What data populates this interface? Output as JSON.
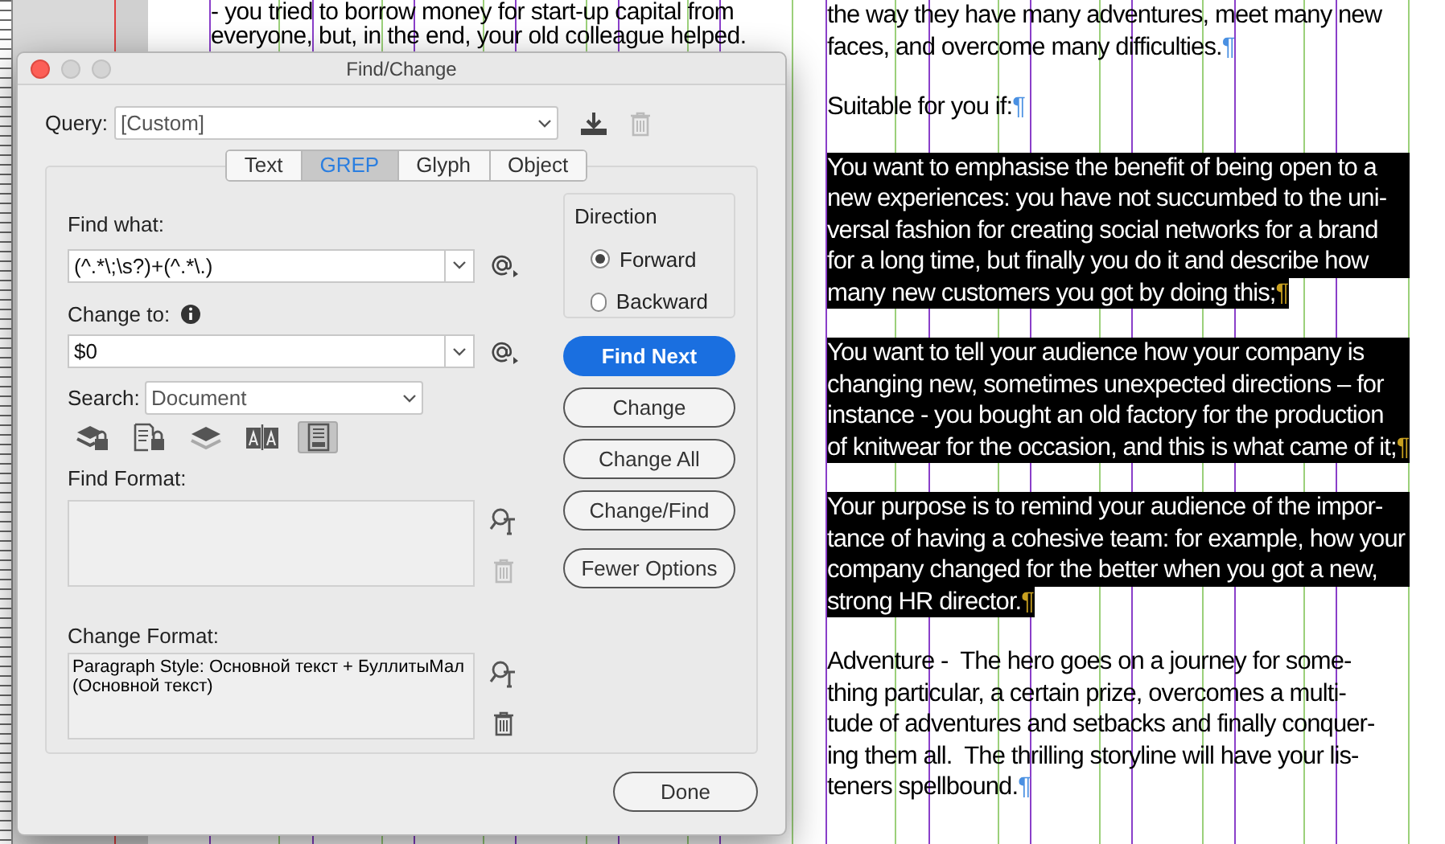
{
  "document": {
    "left_column": {
      "lines": [
        "- you tried to borrow money for start-up capital from",
        "everyone, but, in the end, your old colleague helped."
      ]
    },
    "right_column": {
      "paragraphs": [
        {
          "lines": [
            "the way they have many adventures, meet many new",
            "faces, and overcome many difficulties."
          ],
          "highlighted": false,
          "end_mark": "¶"
        },
        {
          "lines": [
            "Suitable for you if:"
          ],
          "highlighted": false,
          "end_mark": "¶"
        },
        {
          "lines": [
            "You want to emphasise the benefit of being open to a",
            "new experiences: you have not succumbed to the uni-",
            "versal fashion for creating social networks for a brand",
            "for a long time, but finally you do it and describe how",
            "many new customers you got by doing this;"
          ],
          "highlighted": true,
          "end_mark": "¶"
        },
        {
          "lines": [
            "You want to tell your audience how your company is",
            "changing new, sometimes unexpected directions – for",
            "instance - you bought an old factory for the production",
            "of knitwear for the occasion, and this is what came of it;"
          ],
          "highlighted": true,
          "end_mark": "¶"
        },
        {
          "lines": [
            "Your purpose is to remind your audience of the impor-",
            "tance of having a cohesive team: for example, how your",
            "company changed for the better when you got a new,",
            "strong HR director."
          ],
          "highlighted": true,
          "end_mark": "¶"
        },
        {
          "lines": [
            "Adventure -  The hero goes on a journey for some-",
            "thing particular, a certain prize, overcomes a multi-",
            "tude of adventures and setbacks and finally conquer-",
            "ing them all.  The thrilling storyline will have your lis-",
            "teners spellbound."
          ],
          "highlighted": false,
          "end_mark": "¶"
        }
      ]
    }
  },
  "dialog": {
    "title": "Find/Change",
    "query": {
      "label": "Query:",
      "value": "[Custom]"
    },
    "tabs": [
      {
        "label": "Text",
        "selected": false
      },
      {
        "label": "GREP",
        "selected": true
      },
      {
        "label": "Glyph",
        "selected": false
      },
      {
        "label": "Object",
        "selected": false
      }
    ],
    "find_what": {
      "label": "Find what:",
      "value": "(^.*\\;\\s?)+(^.*\\.)"
    },
    "change_to": {
      "label": "Change to:",
      "value": "$0"
    },
    "search": {
      "label": "Search:",
      "value": "Document"
    },
    "search_options": [
      {
        "kind": "locked-layers",
        "selected": false
      },
      {
        "kind": "locked-stories",
        "selected": false
      },
      {
        "kind": "hidden-layers",
        "selected": false
      },
      {
        "kind": "case",
        "selected": false
      },
      {
        "kind": "footnotes",
        "selected": true
      }
    ],
    "find_format": {
      "label": "Find Format:"
    },
    "change_format": {
      "label": "Change Format:",
      "value": "Paragraph Style: Основной текст + БуллитыМал (Основной текст)"
    },
    "direction": {
      "title": "Direction",
      "options": [
        {
          "label": "Forward",
          "selected": true
        },
        {
          "label": "Backward",
          "selected": false
        }
      ]
    },
    "buttons": [
      {
        "label": "Find Next",
        "kind": "primary"
      },
      {
        "label": "Change",
        "kind": "normal"
      },
      {
        "label": "Change All",
        "kind": "normal"
      },
      {
        "label": "Change/Find",
        "kind": "normal"
      },
      {
        "label": "Fewer Options",
        "kind": "normal"
      }
    ],
    "done": "Done"
  }
}
